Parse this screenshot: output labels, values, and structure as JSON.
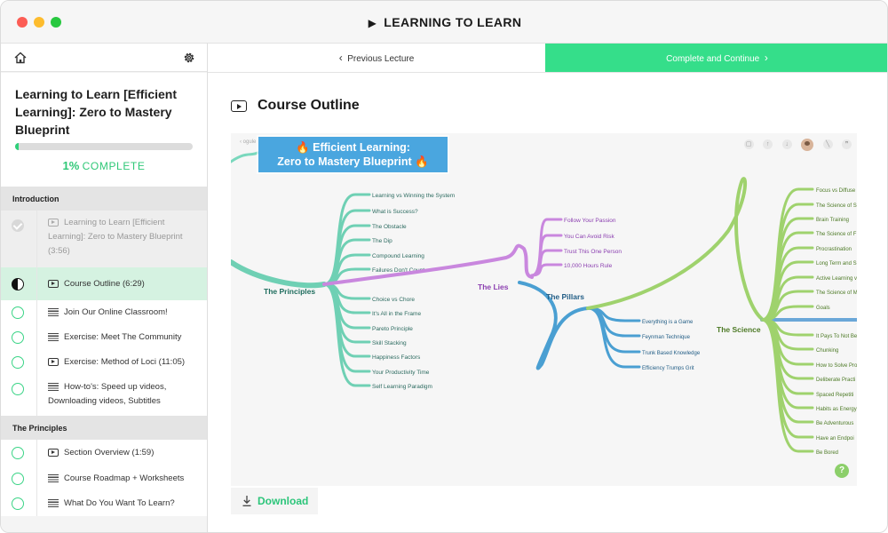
{
  "window": {
    "title": "LEARNING TO LEARN"
  },
  "sidebar": {
    "course_title": "Learning to Learn [Efficient Learning]: Zero to Mastery Blueprint",
    "progress": {
      "percent_value": 0.01,
      "percent_text": "1%",
      "label": "COMPLETE"
    },
    "sections": [
      {
        "title": "Introduction",
        "lectures": [
          {
            "label": "Learning to Learn [Efficient Learning]: Zero to Mastery Blueprint (3:56)",
            "icon": "video-icon",
            "status": "completed"
          },
          {
            "label": "Course Outline (6:29)",
            "icon": "video-icon",
            "status": "in-progress"
          },
          {
            "label": "Join Our Online Classroom!",
            "icon": "text-icon",
            "status": "not-started"
          },
          {
            "label": "Exercise: Meet The Community",
            "icon": "text-icon",
            "status": "not-started"
          },
          {
            "label": "Exercise: Method of Loci (11:05)",
            "icon": "video-icon",
            "status": "not-started"
          },
          {
            "label": "How-to's: Speed up videos, Downloading videos, Subtitles",
            "icon": "text-icon",
            "status": "not-started"
          }
        ]
      },
      {
        "title": "The Principles",
        "lectures": [
          {
            "label": "Section Overview (1:59)",
            "icon": "video-icon",
            "status": "not-started"
          },
          {
            "label": "Course Roadmap + Worksheets",
            "icon": "text-icon",
            "status": "not-started"
          },
          {
            "label": "What Do You Want To Learn?",
            "icon": "text-icon",
            "status": "not-started"
          }
        ]
      }
    ]
  },
  "nav": {
    "previous_label": "Previous Lecture",
    "next_label": "Complete and Continue"
  },
  "content": {
    "title": "Course Outline",
    "download_label": "Download",
    "mindmap": {
      "back_label": "‹ ogule",
      "help_label": "?",
      "central": {
        "line1": "🔥 Efficient Learning:",
        "line2": "Zero to Mastery Blueprint 🔥"
      },
      "colors": {
        "principles": "#6fd0b4",
        "lies": "#c987de",
        "pillars": "#4a9fd2",
        "science": "#9fd26d",
        "central": "#4aa6df"
      },
      "branches": {
        "principles": {
          "label": "The Principles",
          "items": [
            "Learning vs Winning the System",
            "What is Success?",
            "The Obstacle",
            "The Dip",
            "Compound Learning",
            "Failures Don't Count",
            "Choice vs Chore",
            "It's All in the Frame",
            "Pareto Principle",
            "Skill Stacking",
            "Happiness Factors",
            "Your Productivity Time",
            "Self Learning Paradigm"
          ]
        },
        "lies": {
          "label": "The Lies",
          "items": [
            "Follow Your Passion",
            "You Can Avoid Risk",
            "Trust This One Person",
            "10,000 Hours Rule"
          ]
        },
        "pillars": {
          "label": "The Pillars",
          "items": [
            "Everything is a Game",
            "Feynman Technique",
            "Trunk Based Knowledge",
            "Efficiency Trumps Grit"
          ]
        },
        "science": {
          "label": "The Science",
          "items": [
            "Focus vs Diffuse",
            "The Science of S",
            "Brain Training",
            "The Science of F",
            "Procrastination",
            "Long Term and S",
            "Active Learning v",
            "The Science of M",
            "Goals",
            "It Pays To Not Be",
            "Chunking",
            "How to Solve Pro",
            "Deliberate Practi",
            "Spaced Repetiti",
            "Habits as Energy",
            "Be Adventurous",
            "Have an Endpoi",
            "Be Bored"
          ]
        }
      }
    }
  }
}
